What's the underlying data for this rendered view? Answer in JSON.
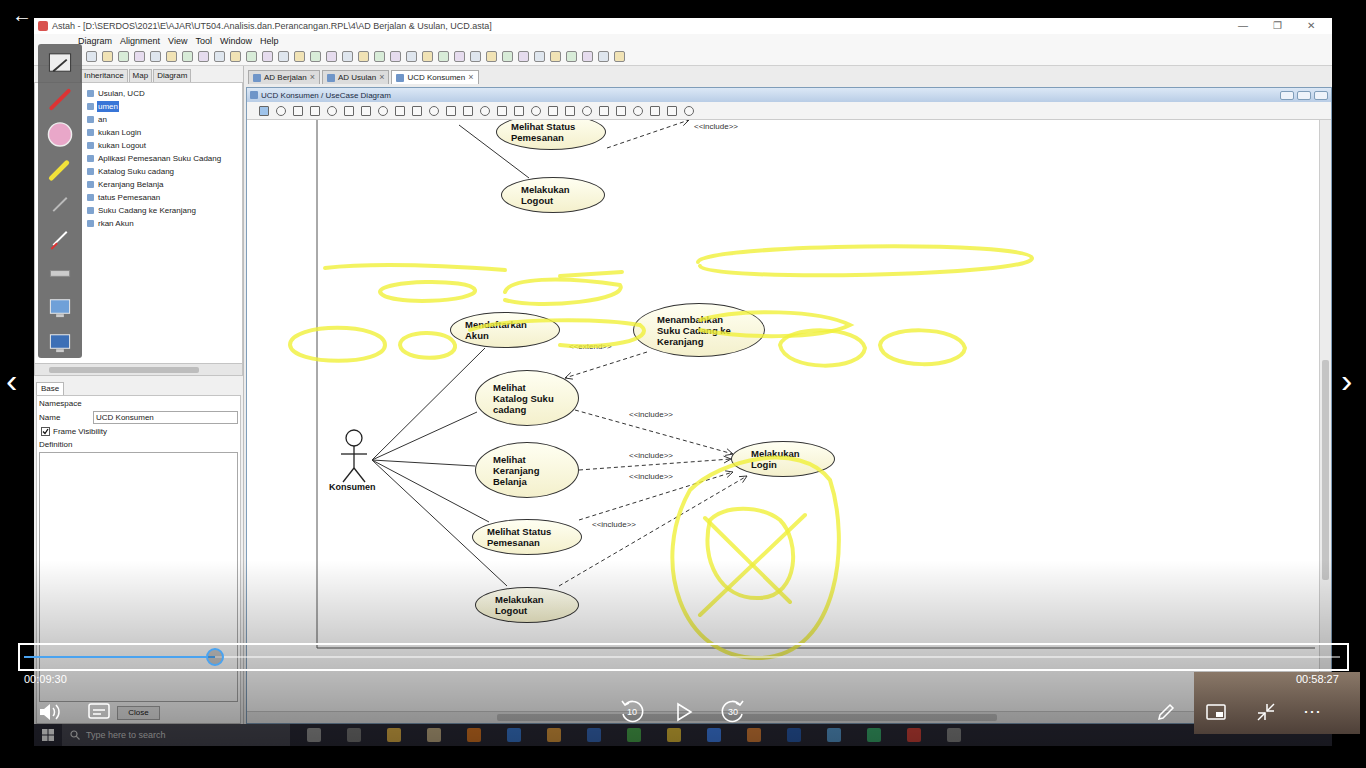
{
  "player": {
    "back": "←",
    "prev": "‹",
    "next": "›",
    "progress": {
      "level": 0.145
    },
    "time_current": "00:09:30",
    "time_total": "00:58:27",
    "rewind": "10",
    "forward": "30",
    "more": "⋯"
  },
  "window": {
    "title": "Astah - [D:\\SERDOS\\2021\\E\\AJAR\\UT504.Analisis.dan.Perancangan.RPL\\4\\AD Berjalan & Usulan, UCD.asta]",
    "controls": [
      "—",
      "❐",
      "✕"
    ],
    "menu": [
      "Diagram",
      "Alignment",
      "View",
      "Tool",
      "Window",
      "Help"
    ]
  },
  "left_panel": {
    "tabs": [
      {
        "label": "Inheritance",
        "selected": false
      },
      {
        "label": "Map",
        "selected": false
      },
      {
        "label": "Diagram",
        "selected": false
      }
    ],
    "tree": [
      {
        "label": "Usulan, UCD",
        "selected": false
      },
      {
        "label": "umen",
        "selected": true
      },
      {
        "label": "an",
        "selected": false
      },
      {
        "label": "kukan Login",
        "selected": false
      },
      {
        "label": "kukan Logout",
        "selected": false
      },
      {
        "label": "Aplikasi Pemesanan Suku Cadang",
        "selected": false
      },
      {
        "label": "Katalog Suku cadang",
        "selected": false
      },
      {
        "label": "Keranjang Belanja",
        "selected": false
      },
      {
        "label": "tatus Pemesanan",
        "selected": false
      },
      {
        "label": "Suku Cadang ke Keranjang",
        "selected": false
      },
      {
        "label": "rkan Akun",
        "selected": false
      }
    ]
  },
  "properties": {
    "tab": "Base",
    "namespace_label": "Namespace",
    "name_label": "Name",
    "name_value": "UCD Konsumen",
    "frame_visibility": {
      "label": "Frame Visibility",
      "checked": true
    },
    "definition_label": "Definition",
    "close": "Close"
  },
  "editor": {
    "tabs": [
      {
        "label": "AD Berjalan",
        "selected": false
      },
      {
        "label": "AD Usulan",
        "selected": false
      },
      {
        "label": "UCD Konsumen",
        "selected": true
      }
    ],
    "close": "×"
  },
  "diagram": {
    "title": "UCD Konsumen / UseCase Diagram",
    "actor": "Konsumen",
    "use_cases": [
      "Melihat Status Pemesanan",
      "Melakukan Logout",
      "Mendaftarkan Akun",
      "Menambahkan Suku Cadang ke Keranjang",
      "Melihat Katalog Suku cadang",
      "Melihat Keranjang Belanja",
      "Melihat Status Pemesanan",
      "Melakukan Logout",
      "Melakukan Login"
    ],
    "relations": [
      {
        "label": "<<include>>"
      },
      {
        "label": "<<extend>>"
      },
      {
        "label": "<<include>>"
      },
      {
        "label": "<<include>>"
      },
      {
        "label": "<<include>>"
      },
      {
        "label": "<<include>>"
      }
    ]
  },
  "taskbar": {
    "search": "Type here to search"
  }
}
